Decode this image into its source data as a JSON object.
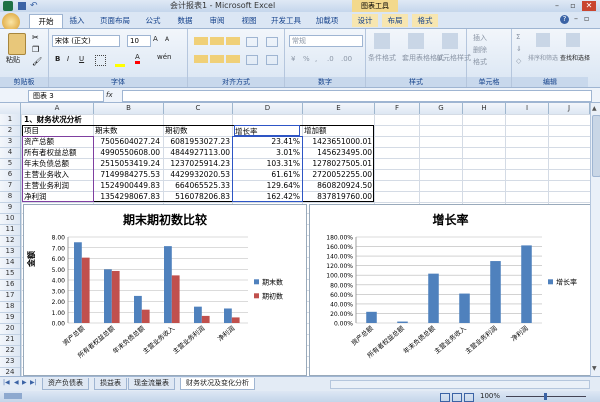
{
  "window": {
    "title": "会计报表1 - Microsoft Excel",
    "context_tab": "图表工具"
  },
  "ribbon_tabs": [
    "开始",
    "插入",
    "页面布局",
    "公式",
    "数据",
    "审阅",
    "视图",
    "开发工具",
    "加载项",
    "设计",
    "布局",
    "格式"
  ],
  "ribbon": {
    "paste": "粘贴",
    "font_name": "宋体 (正文)",
    "font_size": "10",
    "number_format": "常规",
    "groups": [
      "剪贴板",
      "字体",
      "对齐方式",
      "数字",
      "样式",
      "单元格",
      "编辑"
    ],
    "styles_buttons": [
      "条件格式",
      "套用表格格式",
      "单元格样式"
    ],
    "cells_buttons": [
      "插入",
      "删除",
      "格式"
    ],
    "edit_buttons": [
      "排序和筛选",
      "查找和选择"
    ]
  },
  "formula_bar": {
    "name_box": "图表 3",
    "fx": "fx"
  },
  "columns": [
    "A",
    "B",
    "C",
    "D",
    "E",
    "F",
    "G",
    "H",
    "I",
    "J"
  ],
  "rows": [
    "1",
    "2",
    "3",
    "4",
    "5",
    "6",
    "7",
    "8",
    "9",
    "10",
    "11",
    "12",
    "13",
    "14",
    "15",
    "16",
    "17",
    "18",
    "19",
    "20",
    "21",
    "22",
    "23",
    "24"
  ],
  "sheet": {
    "section_title": "1、财务状况分析",
    "headers": [
      "项目",
      "期末数",
      "期初数",
      "增长率",
      "增加额"
    ],
    "rows": [
      [
        "资产总额",
        "7505604027.24",
        "6081953027.23",
        "23.41%",
        "1423651000.01"
      ],
      [
        "所有者权益总额",
        "4990550608.00",
        "4844927113.00",
        "3.01%",
        "145623495.00"
      ],
      [
        "年末负债总额",
        "2515053419.24",
        "1237025914.23",
        "103.31%",
        "1278027505.01"
      ],
      [
        "主营业务收入",
        "7149984275.53",
        "4429932020.53",
        "61.61%",
        "2720052255.00"
      ],
      [
        "主营业务利润",
        "1524900449.83",
        "664065525.33",
        "129.64%",
        "860820924.50"
      ],
      [
        "净利润",
        "1354298067.83",
        "516078206.83",
        "162.42%",
        "837819760.00"
      ]
    ]
  },
  "chart1": {
    "title": "期末期初数比较",
    "ylabel": "金额",
    "yticks": [
      "8.00",
      "7.00",
      "6.00",
      "5.00",
      "4.00",
      "3.00",
      "2.00",
      "1.00",
      "0.00"
    ],
    "legend": [
      "期末数",
      "期初数"
    ]
  },
  "chart2": {
    "title": "增长率",
    "yticks": [
      "180.00%",
      "160.00%",
      "140.00%",
      "120.00%",
      "100.00%",
      "80.00%",
      "60.00%",
      "40.00%",
      "20.00%",
      "0.00%"
    ],
    "legend": [
      "增长率"
    ]
  },
  "chart_data": [
    {
      "type": "bar",
      "title": "期末期初数比较",
      "ylabel": "金额",
      "ylim": [
        0,
        8
      ],
      "categories": [
        "资产总额",
        "所有者权益总额",
        "年末负债总额",
        "主营业务收入",
        "主营业务利润",
        "净利润"
      ],
      "series": [
        {
          "name": "期末数",
          "values": [
            7.51,
            4.99,
            2.52,
            7.15,
            1.52,
            1.35
          ],
          "color": "#4f81bd"
        },
        {
          "name": "期初数",
          "values": [
            6.08,
            4.84,
            1.24,
            4.43,
            0.66,
            0.52
          ],
          "color": "#c0504d"
        }
      ]
    },
    {
      "type": "bar",
      "title": "增长率",
      "ylim": [
        0,
        1.8
      ],
      "categories": [
        "资产总额",
        "所有者权益总额",
        "年末负债总额",
        "主营业务收入",
        "主营业务利润",
        "净利润"
      ],
      "series": [
        {
          "name": "增长率",
          "values": [
            0.2341,
            0.0301,
            1.0331,
            0.6161,
            1.2964,
            1.6242
          ],
          "color": "#4f81bd"
        }
      ]
    }
  ],
  "sheet_tabs": [
    "资产负债表",
    "损益表",
    "现金流量表",
    "财务状况及变化分析"
  ],
  "status": {
    "zoom": "100%"
  }
}
